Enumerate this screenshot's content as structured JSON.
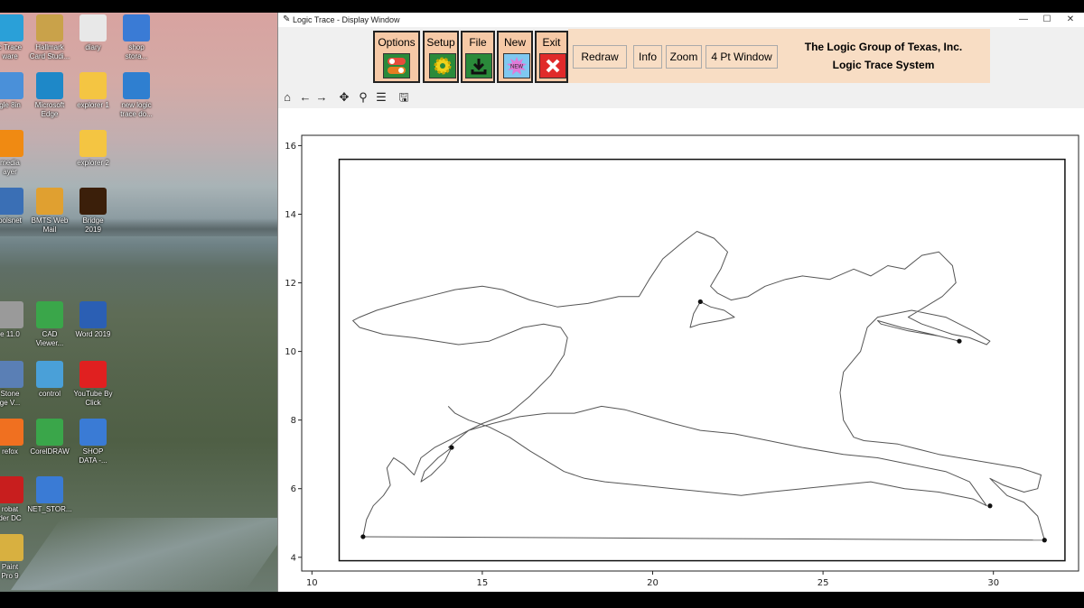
{
  "window": {
    "title": "Logic Trace - Display Window",
    "controls": [
      "—",
      "☐",
      "✕"
    ]
  },
  "toolbar": {
    "options_label": "Options",
    "setup_label": "Setup",
    "file_label": "File",
    "new_label": "New",
    "new_icon_text": "NEW",
    "exit_label": "Exit",
    "redraw_label": "Redraw",
    "info_label": "Info",
    "zoom_label": "Zoom",
    "four_pt_label": "4 Pt Window",
    "company_line1": "The Logic Group of Texas, Inc.",
    "company_line2": "Logic Trace System"
  },
  "nav_icons": [
    "home-icon",
    "back-arrow-icon",
    "forward-arrow-icon",
    "pan-icon",
    "zoom-magnifier-icon",
    "configure-subplots-icon",
    "save-icon"
  ],
  "desktop": {
    "icons": [
      {
        "label": "c Trace\nware",
        "icon": "logic-trace-app-icon",
        "color": "#2aa0d8"
      },
      {
        "label": "Hallmark\nCard Studi...",
        "icon": "hallmark-icon",
        "color": "#c9a24a"
      },
      {
        "label": "diary",
        "icon": "document-icon",
        "color": "#e8e8e8"
      },
      {
        "label": "shop\nstora...",
        "icon": "computer-shortcut-icon",
        "color": "#3a7bd5"
      },
      {
        "label": "gle 8in",
        "icon": "app-icon",
        "color": "#4a90d9"
      },
      {
        "label": "Microsoft\nEdge",
        "icon": "edge-icon",
        "color": "#1e88c8"
      },
      {
        "label": "explorer 1",
        "icon": "folder-icon",
        "color": "#f4c542"
      },
      {
        "label": "new logic\ntrace do...",
        "icon": "grid-app-icon",
        "color": "#2f7fd0"
      },
      {
        "label": "media\nayer",
        "icon": "vlc-icon",
        "color": "#f08a12"
      },
      {
        "label": "explorer 2",
        "icon": "folder-icon",
        "color": "#f4c542"
      },
      {
        "label": "oolsnet",
        "icon": "app-icon",
        "color": "#3a6fb5"
      },
      {
        "label": "BMTS Web\nMail",
        "icon": "key-icon",
        "color": "#e0a030"
      },
      {
        "label": "Bridge\n2019",
        "icon": "bridge-icon",
        "color": "#3b1f0a"
      },
      {
        "label": "e 11.0",
        "icon": "app-icon",
        "color": "#9a9a9a"
      },
      {
        "label": "CAD\nViewer...",
        "icon": "cad-viewer-icon",
        "color": "#3aa64a"
      },
      {
        "label": "Word 2019",
        "icon": "word-icon",
        "color": "#2b5fb4"
      },
      {
        "label": "Stone\nge V...",
        "icon": "app-icon",
        "color": "#5a7fb5"
      },
      {
        "label": "control",
        "icon": "control-panel-icon",
        "color": "#4aa0d8"
      },
      {
        "label": "YouTube By\nClick",
        "icon": "youtube-icon",
        "color": "#e02020"
      },
      {
        "label": "refox",
        "icon": "firefox-icon",
        "color": "#f07020"
      },
      {
        "label": "CorelDRAW",
        "icon": "coreldraw-icon",
        "color": "#3aa64a"
      },
      {
        "label": "SHOP\nDATA -...",
        "icon": "computer-shortcut-icon",
        "color": "#3a7bd5"
      },
      {
        "label": "robat\nder DC",
        "icon": "acrobat-icon",
        "color": "#c81e1e"
      },
      {
        "label": "NET_STOR...",
        "icon": "network-computer-icon",
        "color": "#3a7bd5"
      },
      {
        "label": "Paint\nPro 9",
        "icon": "paint-icon",
        "color": "#d8b040"
      }
    ]
  },
  "chart_data": {
    "type": "line",
    "title": "",
    "xlabel": "",
    "ylabel": "",
    "xlim": [
      9.7,
      32.5
    ],
    "ylim": [
      3.6,
      16.3
    ],
    "xticks": [
      "10",
      "15",
      "20",
      "25",
      "30"
    ],
    "yticks": [
      "4",
      "6",
      "8",
      "10",
      "12",
      "14",
      "16"
    ],
    "x_tick_values": [
      10,
      15,
      20,
      25,
      30
    ],
    "y_tick_values": [
      4,
      6,
      8,
      10,
      12,
      14,
      16
    ],
    "frame": {
      "x": [
        10.8,
        32.1
      ],
      "y": [
        3.9,
        15.6
      ]
    },
    "series": [
      {
        "x": [
          11.5,
          31.5
        ],
        "y": [
          4.6,
          4.5
        ]
      },
      {
        "x": [
          11.5,
          11.6,
          11.8,
          12.1,
          12.3,
          12.2,
          12.4,
          12.7,
          13.0,
          13.2,
          13.6,
          14.2,
          15.0,
          15.8,
          16.4,
          17.0,
          17.4,
          17.5,
          17.3,
          16.8,
          16.2,
          15.2,
          14.3,
          13.0,
          12.1,
          11.4,
          11.2,
          11.4,
          11.9,
          12.6,
          13.4,
          14.2,
          15.0,
          15.6,
          16.4,
          17.2,
          18.1,
          19.0,
          19.6,
          19.9,
          20.3,
          20.9,
          21.3,
          21.8,
          22.2,
          22.0,
          21.7,
          21.9,
          22.3,
          22.8,
          23.3,
          23.9,
          24.4,
          25.2,
          25.9,
          26.4,
          26.9,
          27.4,
          27.9,
          28.4,
          28.8,
          28.9,
          28.5,
          28.0,
          27.5,
          27.9,
          28.5,
          28.8,
          29.3,
          29.8,
          29.9,
          29.4,
          28.6,
          27.6,
          26.6,
          26.3,
          26.1,
          25.6,
          25.5,
          25.6,
          25.9,
          26.2,
          27.2,
          28.4,
          29.6,
          30.8,
          31.4,
          31.3,
          30.9,
          30.3,
          29.9,
          30.4,
          30.9,
          31.3,
          31.5
        ],
        "y": [
          4.6,
          5.1,
          5.5,
          5.8,
          6.1,
          6.6,
          6.9,
          6.7,
          6.4,
          6.9,
          7.2,
          7.5,
          7.9,
          8.2,
          8.7,
          9.3,
          9.9,
          10.4,
          10.7,
          10.8,
          10.7,
          10.3,
          10.2,
          10.4,
          10.5,
          10.7,
          10.9,
          11.0,
          11.2,
          11.4,
          11.6,
          11.8,
          11.9,
          11.8,
          11.5,
          11.3,
          11.4,
          11.6,
          11.6,
          12.1,
          12.7,
          13.2,
          13.5,
          13.3,
          12.9,
          12.4,
          11.9,
          11.7,
          11.5,
          11.6,
          11.9,
          12.1,
          12.2,
          12.1,
          12.4,
          12.2,
          12.5,
          12.4,
          12.8,
          12.9,
          12.5,
          12.0,
          11.6,
          11.3,
          11.0,
          10.8,
          10.6,
          10.5,
          10.4,
          10.2,
          10.3,
          10.6,
          11.0,
          11.2,
          11.0,
          10.7,
          10.0,
          9.4,
          8.8,
          8.0,
          7.5,
          7.4,
          7.3,
          7.0,
          6.8,
          6.6,
          6.4,
          6.0,
          5.9,
          6.1,
          6.3,
          5.8,
          5.6,
          5.2,
          4.5
        ]
      },
      {
        "x": [
          14.1,
          13.7,
          13.3,
          13.2,
          13.5,
          13.9,
          14.1
        ],
        "y": [
          7.2,
          6.9,
          6.5,
          6.2,
          6.4,
          6.8,
          7.2
        ]
      },
      {
        "x": [
          14.0,
          14.6,
          15.3,
          16.1,
          16.9,
          17.7,
          18.5,
          19.2,
          19.9,
          20.6,
          21.4,
          22.4,
          23.4,
          24.4,
          25.6,
          26.6,
          27.6,
          28.6,
          29.3,
          29.8,
          29.4,
          28.4,
          27.4,
          26.4,
          25.4,
          24.4,
          23.4,
          22.6,
          21.6,
          20.6,
          19.6,
          18.6,
          18.0,
          17.4,
          16.9,
          16.4,
          15.8,
          15.2,
          14.6,
          14.2,
          14.0
        ],
        "y": [
          7.2,
          7.7,
          7.9,
          8.1,
          8.2,
          8.2,
          8.4,
          8.3,
          8.1,
          7.9,
          7.7,
          7.6,
          7.4,
          7.2,
          7.0,
          6.9,
          6.7,
          6.5,
          6.2,
          5.5,
          5.7,
          5.9,
          6.0,
          6.2,
          6.1,
          6.0,
          5.9,
          5.8,
          5.9,
          6.0,
          6.1,
          6.2,
          6.3,
          6.5,
          6.8,
          7.1,
          7.5,
          7.8,
          8.0,
          8.2,
          8.4
        ]
      },
      {
        "x": [
          21.4,
          21.7,
          22.1,
          22.4,
          22.0,
          21.4,
          21.1,
          21.2,
          21.4
        ],
        "y": [
          11.45,
          11.3,
          11.2,
          11.0,
          10.9,
          10.8,
          10.7,
          11.1,
          11.45
        ]
      },
      {
        "x": [
          29.0,
          28.2,
          27.3,
          26.6,
          26.7,
          27.5,
          28.4,
          29.0
        ],
        "y": [
          10.3,
          10.5,
          10.7,
          10.9,
          10.8,
          10.6,
          10.45,
          10.3
        ]
      }
    ],
    "endpoints": {
      "x": [
        11.5,
        14.1,
        21.4,
        29.0,
        29.9,
        31.5
      ],
      "y": [
        4.6,
        7.2,
        11.45,
        10.3,
        5.5,
        4.5
      ]
    },
    "grid": false
  }
}
